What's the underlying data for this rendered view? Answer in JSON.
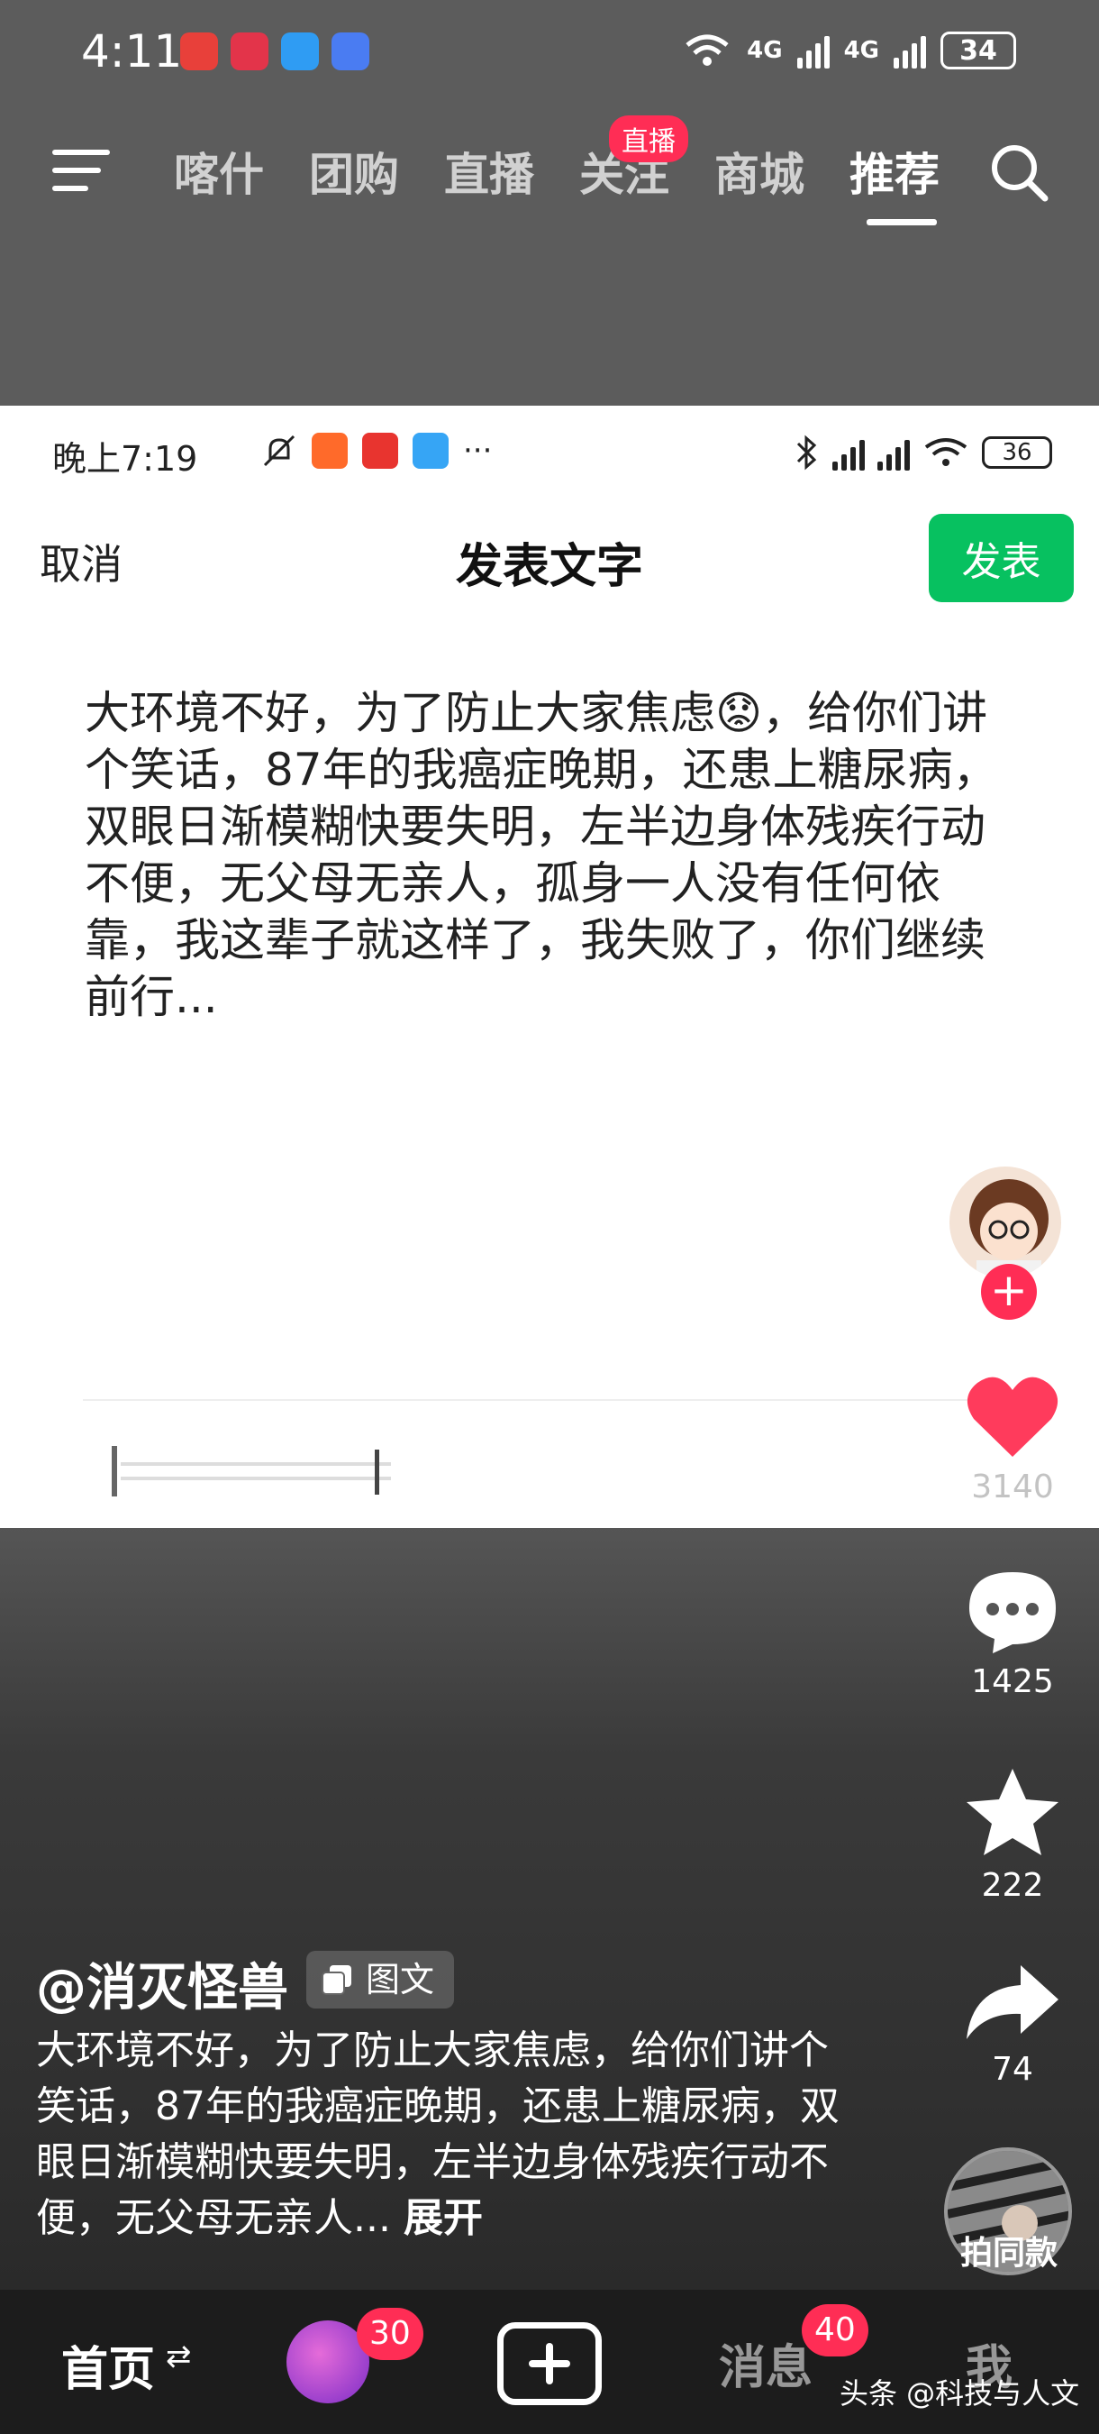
{
  "status_bar": {
    "time": "4:11",
    "network": "4G",
    "network2": "4G",
    "battery": "34"
  },
  "top_nav": {
    "tabs": [
      {
        "label": "喀什",
        "active": false
      },
      {
        "label": "团购",
        "active": false
      },
      {
        "label": "直播",
        "active": false
      },
      {
        "label": "关注",
        "active": false
      },
      {
        "label": "商城",
        "active": false
      },
      {
        "label": "推荐",
        "active": true
      }
    ],
    "live_badge": "直播",
    "icons": [
      "menu-icon",
      "search-icon"
    ]
  },
  "post_screenshot": {
    "inner_time": "晚上7:19",
    "inner_more": "···",
    "inner_battery": "36",
    "cancel": "取消",
    "title": "发表文字",
    "publish": "发表",
    "body": "大环境不好，为了防止大家焦虑😟，给你们讲个笑话，87年的我癌症晚期，还患上糖尿病，双眼日渐模糊快要失明，左半边身体残疾行动不便，无父母无亲人，孤身一人没有任何依靠，我这辈子就这样了，我失败了，你们继续前行..."
  },
  "actions": {
    "likes": "3140",
    "comments": "1425",
    "favorites": "222",
    "shares": "74",
    "follow": "+",
    "same_style": "拍同款"
  },
  "author": {
    "handle": "@消灭怪兽",
    "type_badge": "图文"
  },
  "caption": {
    "text": "大环境不好，为了防止大家焦虑，给你们讲个笑话，87年的我癌症晚期，还患上糖尿病，双眼日渐模糊快要失明，左半边身体残疾行动不便，无父母无亲人...",
    "expand": "展开"
  },
  "bottom_nav": {
    "home": "首页",
    "home_switch": "⇄",
    "friends_badge": "30",
    "messages": "消息",
    "messages_badge": "40",
    "me": "我",
    "watermark": "头条 @科技与人文"
  },
  "colors": {
    "publish_green": "#07c160",
    "badge_red": "#ff2d55",
    "like_red": "#ff3b5c"
  }
}
